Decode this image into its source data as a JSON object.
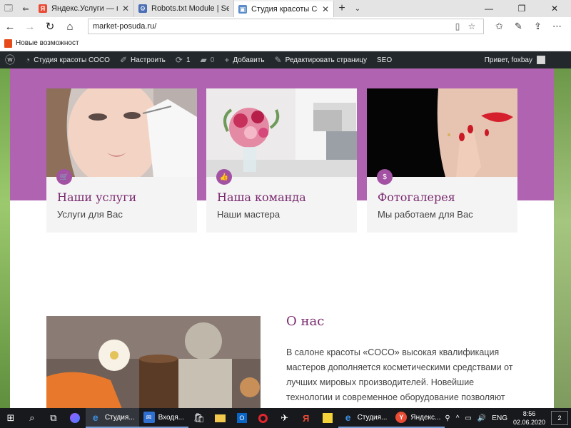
{
  "browser": {
    "tabs": [
      {
        "title": "Яндекс.Услуги — поиск усл",
        "active": false
      },
      {
        "title": "Robots.txt Module | Semper",
        "active": false
      },
      {
        "title": "Студия красоты COCO",
        "active": true
      }
    ],
    "url": "market-posuda.ru/",
    "favorites": [
      {
        "label": "Новые возможност"
      }
    ]
  },
  "adminbar": {
    "site_name": "Студия красоты COCO",
    "customize": "Настроить",
    "updates_count": "1",
    "comments_count": "0",
    "add_new": "Добавить",
    "edit_page": "Редактировать страницу",
    "seo": "SEO",
    "greeting": "Привет, foxbay"
  },
  "cards": [
    {
      "title": "Наши услуги",
      "subtitle": "Услуги для Вас",
      "badge_icon": "cart-icon"
    },
    {
      "title": "Наша команда",
      "subtitle": "Наши мастера",
      "badge_icon": "thumbs-up-icon"
    },
    {
      "title": "Фотогалерея",
      "subtitle": "Мы работаем для Вас",
      "badge_icon": "money-icon"
    }
  ],
  "about": {
    "title": "О нас",
    "text": "В салоне красоты «COCO» высокая квалификация мастеров дополняется косметическими средствами от лучших мировых производителей. Новейшие технологии и современное оборудование позволяют"
  },
  "taskbar": {
    "apps": [
      {
        "label": "Студия...",
        "active": true
      },
      {
        "label": "Входя...",
        "badge": "2",
        "active": false
      },
      {
        "label": "Студия...",
        "active": false
      },
      {
        "label": "Яндекс...",
        "active": false
      }
    ],
    "language": "ENG",
    "time": "8:56",
    "date": "02.06.2020",
    "notification_count": "2"
  },
  "colors": {
    "hero": "#b063b0",
    "accent": "#7a2a6f",
    "admin_bar": "#23282d",
    "taskbar": "#17191c"
  }
}
